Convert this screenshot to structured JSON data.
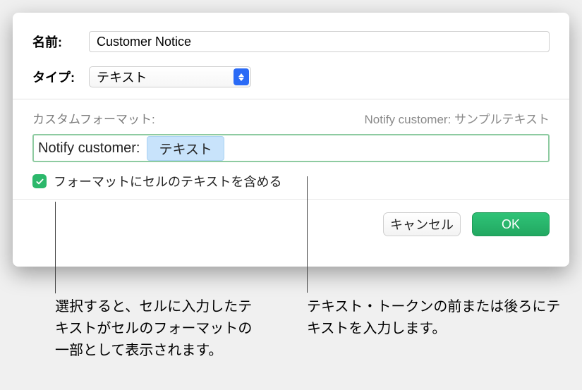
{
  "name_row": {
    "label": "名前:",
    "value": "Customer Notice"
  },
  "type_row": {
    "label": "タイプ:",
    "value": "テキスト"
  },
  "custom_format": {
    "label": "カスタムフォーマット:",
    "preview": "Notify customer: サンプルテキスト"
  },
  "format_field": {
    "prefix": "Notify customer: ",
    "token": "テキスト"
  },
  "checkbox": {
    "label": "フォーマットにセルのテキストを含める"
  },
  "buttons": {
    "cancel": "キャンセル",
    "ok": "OK"
  },
  "callouts": {
    "left": "選択すると、セルに入力したテキストがセルのフォーマットの一部として表示されます。",
    "right": "テキスト・トークンの前または後ろにテキストを入力します。"
  }
}
